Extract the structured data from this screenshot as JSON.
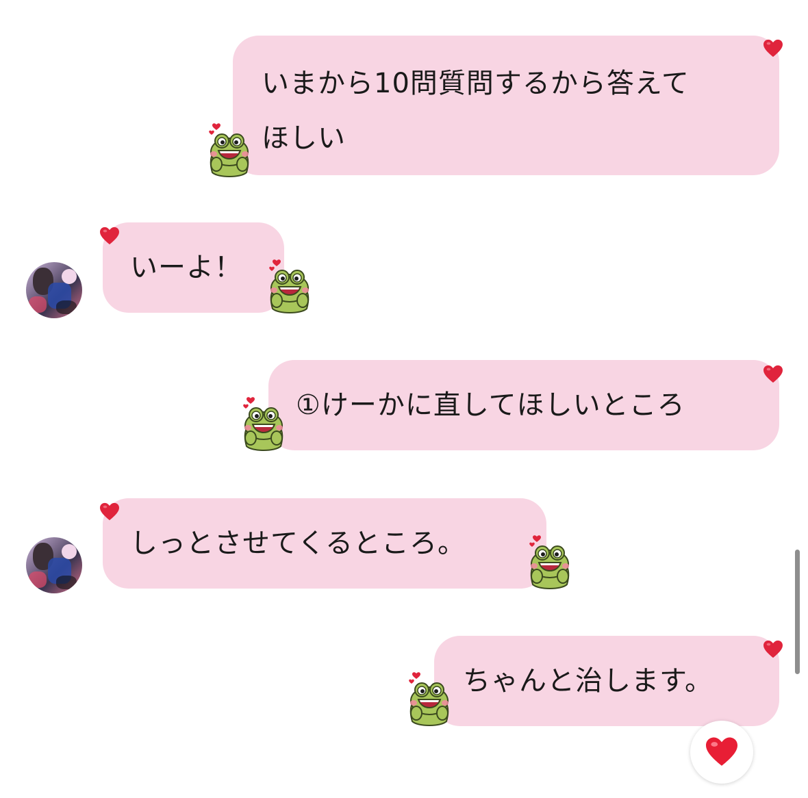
{
  "chat": {
    "messages": [
      {
        "sender": "me",
        "text": "いまから10問質問するから答えて\nほしい"
      },
      {
        "sender": "other",
        "text": "いーよ！"
      },
      {
        "sender": "me",
        "text": "①けーかに直してほしいところ"
      },
      {
        "sender": "other",
        "text": "しっとさせてくるところ。"
      },
      {
        "sender": "me",
        "text": "ちゃんと治します。"
      }
    ]
  },
  "reaction": {
    "icon": "heart-icon"
  },
  "colors": {
    "bubble": "#f8d5e3",
    "heart": "#e0243c",
    "frog_green": "#a8c65a",
    "text": "#1a1a1a",
    "background": "#ffffff"
  }
}
